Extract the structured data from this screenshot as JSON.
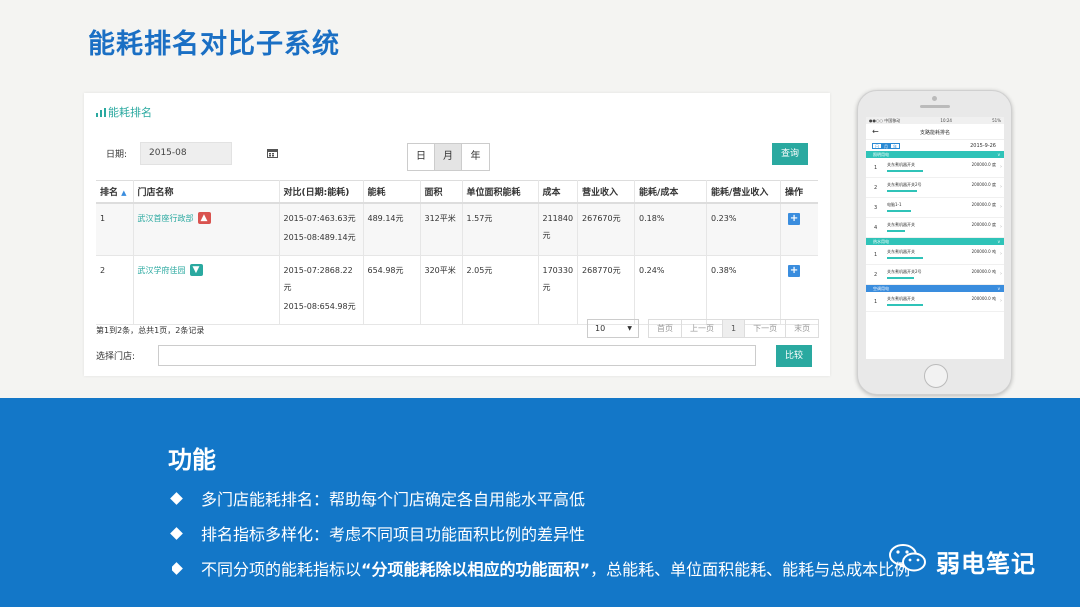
{
  "page_title": "能耗排名对比子系统",
  "panel": {
    "title": "能耗排名",
    "date_label": "日期:",
    "date_value": "2015-08",
    "period_tabs": [
      "日",
      "月",
      "年"
    ],
    "active_period": "月",
    "query_label": "查询",
    "columns": [
      "排名",
      "门店名称",
      "对比(日期:能耗)",
      "能耗",
      "面积",
      "单位面积能耗",
      "成本",
      "营业收入",
      "能耗/成本",
      "能耗/营业收入",
      "操作"
    ],
    "sort_indicator": "▲",
    "rows": [
      {
        "rank": "1",
        "store": "武汉首座行政部",
        "trend": "up",
        "cmp1": "2015-07:463.63元",
        "cmp2": "2015-08:489.14元",
        "energy": "489.14元",
        "area": "312平米",
        "unit": "1.57元",
        "cost": "211840元",
        "revenue": "267670元",
        "ratio_cost": "0.18%",
        "ratio_rev": "0.23%"
      },
      {
        "rank": "2",
        "store": "武汉学府佳园",
        "trend": "down",
        "cmp1": "2015-07:2868.22元",
        "cmp2": "2015-08:654.98元",
        "energy": "654.98元",
        "area": "320平米",
        "unit": "2.05元",
        "cost": "170330元",
        "revenue": "268770元",
        "ratio_cost": "0.24%",
        "ratio_rev": "0.38%"
      }
    ],
    "summary": "第1到2条，总共1页，2条记录",
    "page_size": "10",
    "pager": [
      "首页",
      "上一页",
      "1",
      "下一页",
      "末页"
    ],
    "store_label": "选择门店:",
    "compare_label": "比较"
  },
  "phone": {
    "status_left": "●●○○ 中国移动",
    "status_time": "10:24",
    "status_right": "51%",
    "title": "支路能耗排名",
    "tabs": [
      "日",
      "月",
      "年"
    ],
    "date": "2015-9-26",
    "groups": [
      {
        "name": "照明用电",
        "items": [
          {
            "num": "1",
            "name": "关东煮机器开关",
            "value": "200000.0 度",
            "fill": 0.6
          },
          {
            "num": "2",
            "name": "关东煮机器开关2号",
            "value": "200000.0 度",
            "fill": 0.5
          },
          {
            "num": "3",
            "name": "电脑1-1",
            "value": "200000.0 度",
            "fill": 0.4
          },
          {
            "num": "4",
            "name": "关东煮机器开关",
            "value": "200000.0 度",
            "fill": 0.3
          }
        ]
      },
      {
        "name": "热水用电",
        "items": [
          {
            "num": "1",
            "name": "关东煮机器开关",
            "value": "200000.0 吨",
            "fill": 0.6
          },
          {
            "num": "2",
            "name": "关东煮机器开关2号",
            "value": "200000.0 吨",
            "fill": 0.45
          }
        ]
      },
      {
        "name": "空调用电",
        "items": [
          {
            "num": "1",
            "name": "关东煮机器开关",
            "value": "200000.0 吨",
            "fill": 0.6
          }
        ]
      }
    ]
  },
  "features": {
    "title": "功能",
    "bullets": [
      {
        "pre": "多门店能耗排名：帮助每个门店确定各自用能水平高低",
        "bold": "",
        "post": ""
      },
      {
        "pre": "排名指标多样化：考虑不同项目功能面积比例的差异性",
        "bold": "",
        "post": ""
      },
      {
        "pre": "不同分项的能耗指标以",
        "bold": "“分项能耗除以相应的功能面积”",
        "post": "，总能耗、单位面积能耗、能耗与总成本比例"
      }
    ]
  },
  "logo_text": "弱电笔记"
}
